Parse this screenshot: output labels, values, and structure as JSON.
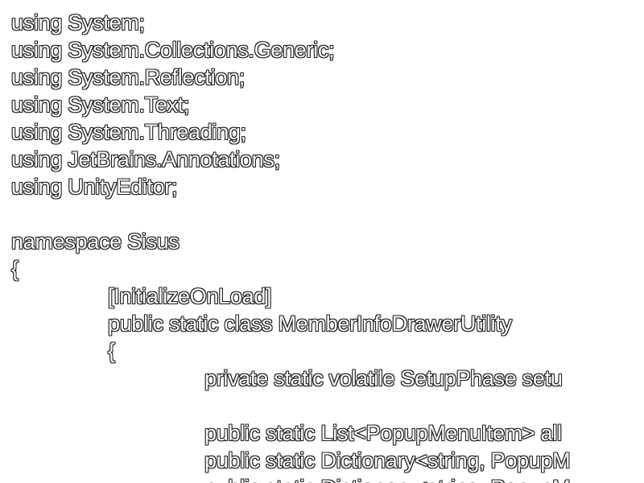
{
  "code": {
    "lines": [
      {
        "indent": 0,
        "text": "using System;"
      },
      {
        "indent": 0,
        "text": "using System.Collections.Generic;"
      },
      {
        "indent": 0,
        "text": "using System.Reflection;"
      },
      {
        "indent": 0,
        "text": "using System.Text;"
      },
      {
        "indent": 0,
        "text": "using System.Threading;"
      },
      {
        "indent": 0,
        "text": "using JetBrains.Annotations;"
      },
      {
        "indent": 0,
        "text": "using UnityEditor;"
      },
      {
        "indent": 0,
        "text": ""
      },
      {
        "indent": 0,
        "text": "namespace Sisus"
      },
      {
        "indent": 0,
        "text": "{"
      },
      {
        "indent": 1,
        "text": "[InitializeOnLoad]"
      },
      {
        "indent": 1,
        "text": "public static class MemberInfoDrawerUtility"
      },
      {
        "indent": 1,
        "text": "{"
      },
      {
        "indent": 2,
        "text": "private static volatile SetupPhase setu"
      },
      {
        "indent": 0,
        "text": ""
      },
      {
        "indent": 2,
        "text": "public static List<PopupMenuItem> all"
      },
      {
        "indent": 2,
        "text": "public static Dictionary<string, PopupM"
      },
      {
        "indent": 2,
        "text": "public static Dictionary<string, PopupM"
      }
    ]
  },
  "colors": {
    "text_fill": "#ffffff",
    "text_outline": "#1a1a1a",
    "background": "#ffffff"
  }
}
